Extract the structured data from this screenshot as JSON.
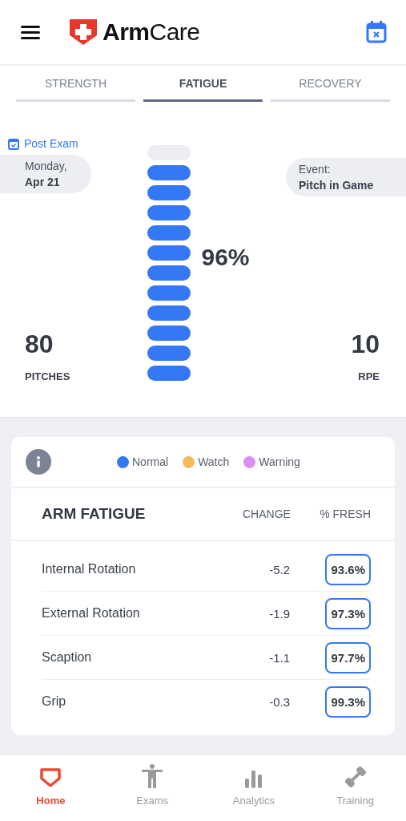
{
  "header": {
    "brand_bold": "Arm",
    "brand_light": "Care"
  },
  "tabs": [
    {
      "label": "STRENGTH",
      "selected": false
    },
    {
      "label": "FATIGUE",
      "selected": true
    },
    {
      "label": "RECOVERY",
      "selected": false
    }
  ],
  "summary": {
    "exam_type": "Post Exam",
    "date_line1": "Monday,",
    "date_line2": "Apr 21",
    "event_label": "Event:",
    "event_value": "Pitch in Game",
    "meter": {
      "level": 0.92,
      "reading": "96%"
    },
    "pitches": "80",
    "pitches_label": "PITCHES",
    "rpe": "10",
    "rpe_label": "RPE"
  },
  "legend": [
    {
      "label": "Normal",
      "color": "#3478f6"
    },
    {
      "label": "Watch",
      "color": "#f4bb5c"
    },
    {
      "label": "Warning",
      "color": "#d98ef2"
    }
  ],
  "table": {
    "title": "ARM FATIGUE",
    "columns": [
      "CHANGE",
      "% FRESH"
    ],
    "rows": [
      {
        "name": "Internal Rotation",
        "change": "-5.2",
        "fresh": "93.6%",
        "color": "#3478f6"
      },
      {
        "name": "External Rotation",
        "change": "-1.9",
        "fresh": "97.3%",
        "color": "#3478f6"
      },
      {
        "name": "Scaption",
        "change": "-1.1",
        "fresh": "97.7%",
        "color": "#3478f6"
      },
      {
        "name": "Grip",
        "change": "-0.3",
        "fresh": "99.3%",
        "color": "#3478f6"
      }
    ]
  },
  "nav": [
    {
      "label": "Home",
      "kind": "home",
      "selected": true
    },
    {
      "label": "Exams",
      "kind": "exams",
      "selected": false
    },
    {
      "label": "Analytics",
      "kind": "analytics",
      "selected": false
    },
    {
      "label": "Training",
      "kind": "training",
      "selected": false
    }
  ]
}
